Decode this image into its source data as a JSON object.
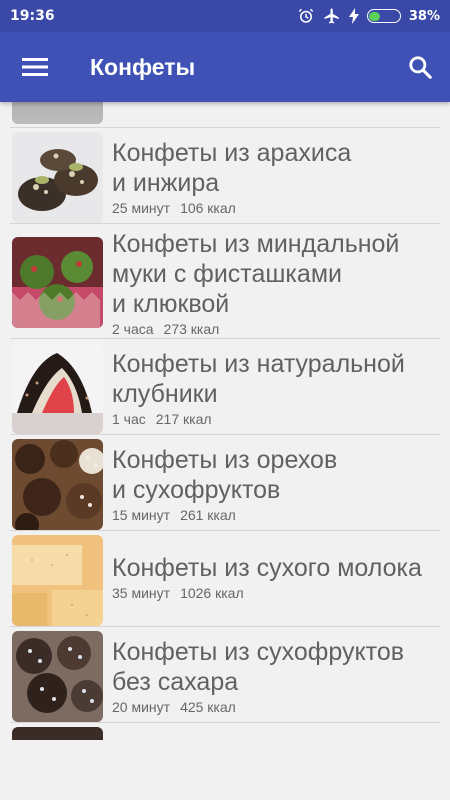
{
  "status": {
    "time": "19:36",
    "battery": "38%",
    "battery_fraction": 0.38,
    "alarm_icon": "alarm-icon",
    "airplane_icon": "airplane-icon",
    "charging_icon": "charging-icon"
  },
  "appbar": {
    "title": "Конфеты",
    "menu_icon": "menu-icon",
    "search_icon": "search-icon"
  },
  "recipes": [
    {
      "title_lines": [
        "Конфеты из арахиса",
        "и инжира"
      ],
      "time": "25 минут",
      "kcal": "106 ккал"
    },
    {
      "title_lines": [
        "Конфеты из миндальной",
        "муки с фисташками",
        "и клюквой"
      ],
      "time": "2 часа",
      "kcal": "273 ккал"
    },
    {
      "title_lines": [
        "Конфеты из натуральной",
        "клубники"
      ],
      "time": "1 час",
      "kcal": "217 ккал"
    },
    {
      "title_lines": [
        "Конфеты из орехов",
        "и сухофруктов"
      ],
      "time": "15 минут",
      "kcal": "261 ккал"
    },
    {
      "title_lines": [
        "Конфеты из сухого молока"
      ],
      "time": "35 минут",
      "kcal": "1026 ккал"
    },
    {
      "title_lines": [
        "Конфеты из сухофруктов",
        "без сахара"
      ],
      "time": "20 минут",
      "kcal": "425 ккал"
    }
  ],
  "colors": {
    "statusbar": "#3a49a8",
    "appbar": "#3f51b5",
    "background": "#f1f1f1"
  }
}
